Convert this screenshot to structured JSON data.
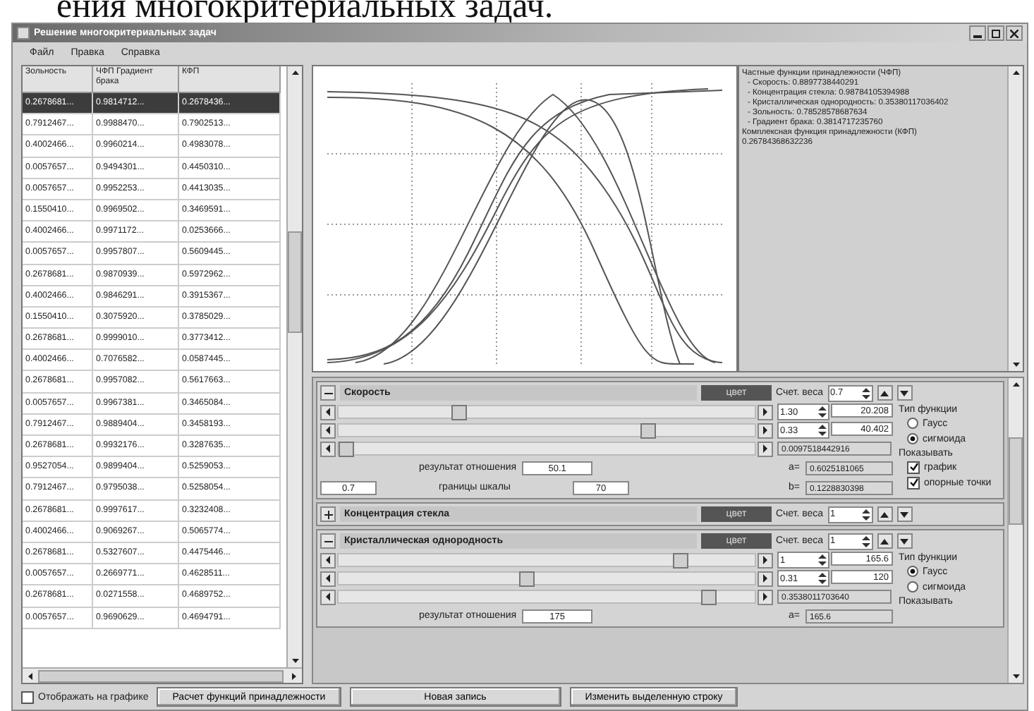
{
  "caption": "ения многокритериальных задач.",
  "window": {
    "title": "Решение многокритериальных задач"
  },
  "menu": [
    "Файл",
    "Правка",
    "Справка"
  ],
  "table": {
    "columns": [
      "Зольность",
      "ЧФП Градиент брака",
      "КФП"
    ],
    "rows": [
      {
        "cells": [
          "0.2678681...",
          "0.9814712...",
          "0.2678436..."
        ],
        "selected": true
      },
      {
        "cells": [
          "0.7912467...",
          "0.9988470...",
          "0.7902513..."
        ],
        "selected": false
      },
      {
        "cells": [
          "0.4002466...",
          "0.9960214...",
          "0.4983078..."
        ],
        "selected": false
      },
      {
        "cells": [
          "0.0057657...",
          "0.9494301...",
          "0.4450310..."
        ],
        "selected": false
      },
      {
        "cells": [
          "0.0057657...",
          "0.9952253...",
          "0.4413035..."
        ],
        "selected": false
      },
      {
        "cells": [
          "0.1550410...",
          "0.9969502...",
          "0.3469591..."
        ],
        "selected": false
      },
      {
        "cells": [
          "0.4002466...",
          "0.9971172...",
          "0.0253666..."
        ],
        "selected": false
      },
      {
        "cells": [
          "0.0057657...",
          "0.9957807...",
          "0.5609445..."
        ],
        "selected": false
      },
      {
        "cells": [
          "0.2678681...",
          "0.9870939...",
          "0.5972962..."
        ],
        "selected": false
      },
      {
        "cells": [
          "0.4002466...",
          "0.9846291...",
          "0.3915367..."
        ],
        "selected": false
      },
      {
        "cells": [
          "0.1550410...",
          "0.3075920...",
          "0.3785029..."
        ],
        "selected": false
      },
      {
        "cells": [
          "0.2678681...",
          "0.9999010...",
          "0.3773412..."
        ],
        "selected": false
      },
      {
        "cells": [
          "0.4002466...",
          "0.7076582...",
          "0.0587445..."
        ],
        "selected": false
      },
      {
        "cells": [
          "0.2678681...",
          "0.9957082...",
          "0.5617663..."
        ],
        "selected": false
      },
      {
        "cells": [
          "0.0057657...",
          "0.9967381...",
          "0.3465084..."
        ],
        "selected": false
      },
      {
        "cells": [
          "0.7912467...",
          "0.9889404...",
          "0.3458193..."
        ],
        "selected": false
      },
      {
        "cells": [
          "0.2678681...",
          "0.9932176...",
          "0.3287635..."
        ],
        "selected": false
      },
      {
        "cells": [
          "0.9527054...",
          "0.9899404...",
          "0.5259053..."
        ],
        "selected": false
      },
      {
        "cells": [
          "0.7912467...",
          "0.9795038...",
          "0.5258054..."
        ],
        "selected": false
      },
      {
        "cells": [
          "0.2678681...",
          "0.9997617...",
          "0.3232408..."
        ],
        "selected": false
      },
      {
        "cells": [
          "0.4002466...",
          "0.9069267...",
          "0.5065774..."
        ],
        "selected": false
      },
      {
        "cells": [
          "0.2678681...",
          "0.5327607...",
          "0.4475446..."
        ],
        "selected": false
      },
      {
        "cells": [
          "0.0057657...",
          "0.2669771...",
          "0.4628511..."
        ],
        "selected": false
      },
      {
        "cells": [
          "0.2678681...",
          "0.0271558...",
          "0.4689752..."
        ],
        "selected": false
      },
      {
        "cells": [
          "0.0057657...",
          "0.9690629...",
          "0.4694791..."
        ],
        "selected": false
      }
    ]
  },
  "result_text": [
    "Частные функции принадлежности (ЧФП)",
    "- Скорость: 0.8897738440291",
    "- Концентрация стекла: 0.98784105394988",
    "- Кристаллическая однородность: 0.35380117036402",
    "- Зольность: 0.78528578687634",
    "- Градиент брака: 0.3814717235760",
    "Комплексная функция принадлежности (КФП)",
    "0.26784368632236"
  ],
  "criteria": [
    {
      "name": "Скорость",
      "expanded": true,
      "color_button": "цвет",
      "weight_label": "Счет. веса",
      "weight": "0.7",
      "sliders": [
        {
          "level": 0.28
        },
        {
          "level": 0.75
        },
        {
          "level": 0.0
        }
      ],
      "ranges": [
        {
          "low": "1.30",
          "high": "20.208"
        },
        {
          "low": "0.33",
          "high": "40.402"
        }
      ],
      "param": "0.0097518442916",
      "function_type": {
        "label": "Тип функции",
        "options": [
          {
            "label": "Гаусс",
            "selected": false
          },
          {
            "label": "сигмоида",
            "selected": true
          }
        ]
      },
      "result_label": "результат отношения",
      "result": "50.1",
      "min": "0.7",
      "scale_label": "границы шкалы",
      "max": "70",
      "coefs": [
        {
          "label": "a=",
          "value": "0.6025181065"
        },
        {
          "label": "b=",
          "value": "0.1228830398"
        }
      ],
      "show": {
        "label": "Показывать",
        "options": [
          {
            "label": "график",
            "checked": true
          },
          {
            "label": "опорные точки",
            "checked": true
          }
        ]
      }
    },
    {
      "name": "Концентрация стекла",
      "expanded": false,
      "color_button": "цвет",
      "weight_label": "Счет. веса",
      "weight": "1"
    },
    {
      "name": "Кристаллическая однородность",
      "expanded": true,
      "color_button": "цвет",
      "weight_label": "Счет. веса",
      "weight": "1",
      "sliders": [
        {
          "level": 0.83
        },
        {
          "level": 0.45
        },
        {
          "level": 0.9
        }
      ],
      "ranges": [
        {
          "low": "1",
          "high": "165.6"
        },
        {
          "low": "0.31",
          "high": "120"
        }
      ],
      "param": "0.3538011703640",
      "function_type": {
        "label": "Тип функции",
        "options": [
          {
            "label": "Гаусс",
            "selected": true
          },
          {
            "label": "сигмоида",
            "selected": false
          }
        ]
      },
      "result_label": "результат отношения",
      "result": "175",
      "coefs": [
        {
          "label": "a=",
          "value": "165.6"
        }
      ],
      "show": {
        "label": "Показывать"
      }
    }
  ],
  "show_on_chart": {
    "label": "Отображать на графике",
    "checked": false
  },
  "buttons": [
    "Расчет функций принадлежности",
    "Новая запись",
    "Изменить выделенную строку"
  ]
}
